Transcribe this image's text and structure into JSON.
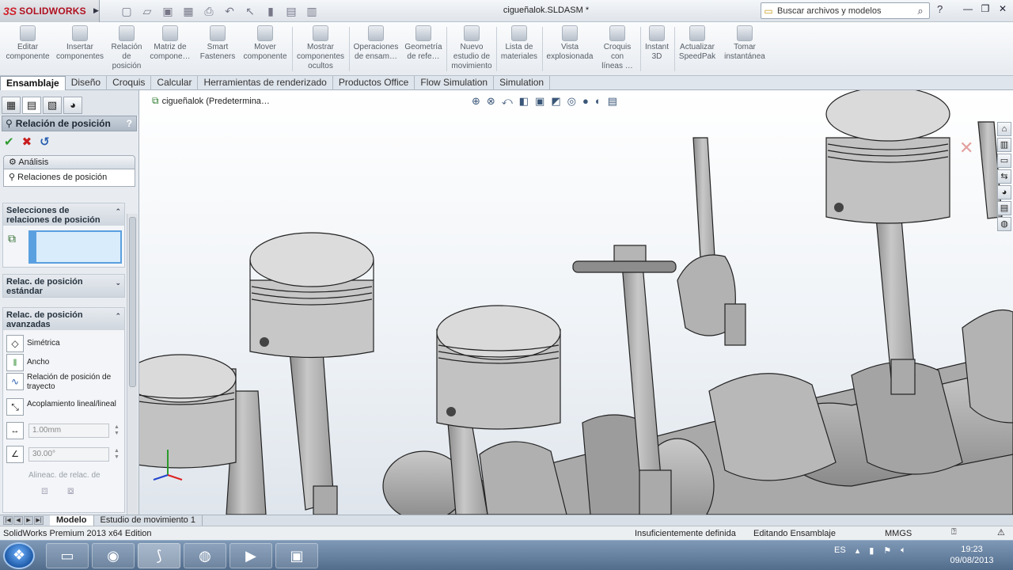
{
  "app": {
    "brand": "SOLIDWORKS",
    "brand_mark": "3S",
    "document_title": "cigueñalok.SLDASM *"
  },
  "titlebar": {
    "search_placeholder": "Buscar archivos y modelos",
    "help_icon": "?"
  },
  "commands": [
    {
      "label": "Editar\ncomponente"
    },
    {
      "label": "Insertar\ncomponentes"
    },
    {
      "label": "Relación\nde\nposición"
    },
    {
      "label": "Matriz de\ncompone…"
    },
    {
      "label": "Smart\nFasteners"
    },
    {
      "label": "Mover\ncomponente"
    },
    {
      "label": "Mostrar\ncomponentes\nocultos"
    },
    {
      "label": "Operaciones\nde ensam…"
    },
    {
      "label": "Geometría\nde refe…"
    },
    {
      "label": "Nuevo\nestudio de\nmovimiento"
    },
    {
      "label": "Lista de\nmateriales"
    },
    {
      "label": "Vista\nexplosionada"
    },
    {
      "label": "Croquis\ncon\nlíneas …"
    },
    {
      "label": "Instant\n3D"
    },
    {
      "label": "Actualizar\nSpeedPak"
    },
    {
      "label": "Tomar\ninstantánea"
    }
  ],
  "tabs": [
    "Ensamblaje",
    "Diseño",
    "Croquis",
    "Calcular",
    "Herramientas de renderizado",
    "Productos Office",
    "Flow Simulation",
    "Simulation"
  ],
  "panel": {
    "title": "Relación de posición",
    "help": "?",
    "subtab_analysis": "Análisis",
    "subtab_mates": "Relaciones de posición",
    "group_selections": "Selecciones de relaciones de posición",
    "group_standard": "Relac. de posición estándar",
    "group_advanced": "Relac. de posición avanzadas",
    "options": [
      {
        "label": "Simétrica"
      },
      {
        "label": "Ancho"
      },
      {
        "label": "Relación de posición de trayecto"
      },
      {
        "label": "Acoplamiento lineal/lineal"
      }
    ],
    "distance_value": "1.00mm",
    "angle_value": "30.00°",
    "alignment_label": "Alineac. de relac. de"
  },
  "viewport": {
    "tree_root": "cigueñalok  (Predetermina…"
  },
  "bottom_tabs": [
    "Modelo",
    "Estudio de movimiento 1"
  ],
  "status": {
    "edition": "SolidWorks Premium 2013 x64 Edition",
    "definition": "Insuficientemente definida",
    "mode": "Editando Ensamblaje",
    "units": "MMGS"
  },
  "taskbar": {
    "language": "ES",
    "time": "19:23",
    "date": "09/08/2013"
  }
}
